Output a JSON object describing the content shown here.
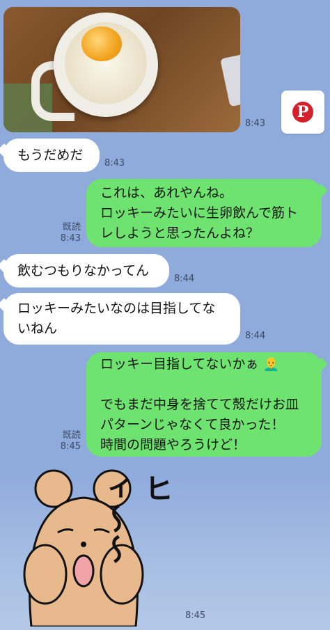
{
  "messages": [
    {
      "side": "left",
      "type": "image",
      "time": "8:43"
    },
    {
      "side": "left",
      "text": "もうだめだ",
      "time": "8:43"
    },
    {
      "side": "right",
      "text": "これは、あれやんね。\nロッキーみたいに生卵飲んで筋ト\nレしようと思ったんよね？",
      "read": "既読",
      "time": "8:43"
    },
    {
      "side": "left",
      "text": "飲むつもりなかってん",
      "time": "8:44"
    },
    {
      "side": "left",
      "text": "ロッキーみたいなのは目指してな\nいねん",
      "time": "8:44"
    },
    {
      "side": "right",
      "text": "ロッキー目指してないかぁ 👨‍🦲\n\nでもまだ中身を捨てて殻だけお皿\nパターンじゃなくて良かった！\n時間の問題やろうけど！",
      "read": "既読",
      "time": "8:45"
    },
    {
      "side": "left",
      "type": "sticker",
      "sticker_text": "ヒィ〜〜",
      "time": "8:45"
    }
  ],
  "share_button": {
    "icon": "pinterest-icon",
    "glyph": "P"
  },
  "colors": {
    "background": "#8fabdc",
    "right_bubble": "#6fe36f",
    "left_bubble": "#ffffff"
  }
}
